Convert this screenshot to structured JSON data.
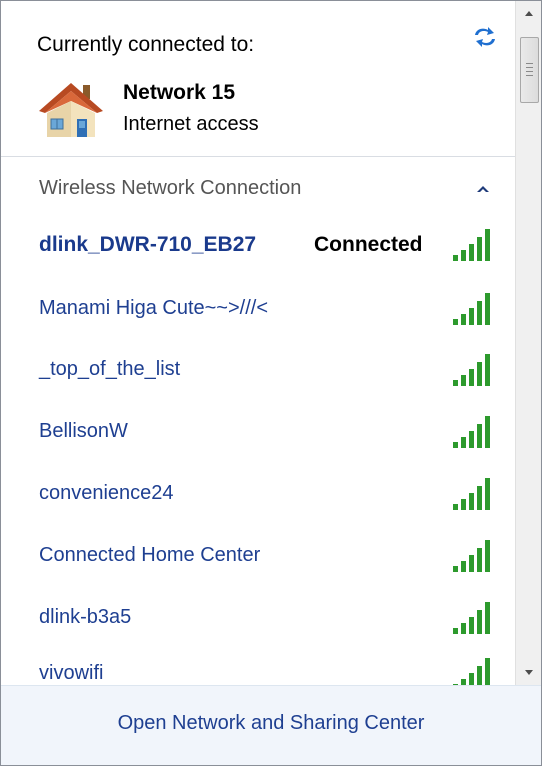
{
  "header": {
    "title": "Currently connected to:",
    "refresh_icon": "refresh-arrows-icon"
  },
  "current_network": {
    "icon": "home-network-icon",
    "name": "Network  15",
    "status": "Internet access"
  },
  "section": {
    "title": "Wireless Network Connection",
    "toggle_icon": "chevron-up-icon"
  },
  "networks": [
    {
      "name": "dlink_DWR-710_EB27",
      "status": "Connected"
    },
    {
      "name": "Manami Higa Cute~~>///<"
    },
    {
      "name": "_top_of_the_list"
    },
    {
      "name": "BellisonW"
    },
    {
      "name": "convenience24"
    },
    {
      "name": "Connected Home Center"
    },
    {
      "name": "dlink-b3a5"
    },
    {
      "name": "vivowifi"
    }
  ],
  "colors": {
    "link": "#1e3f91",
    "signal": "#2d9a2d",
    "footer_bg": "#f1f5fb"
  },
  "footer": {
    "link": "Open Network and Sharing Center"
  }
}
